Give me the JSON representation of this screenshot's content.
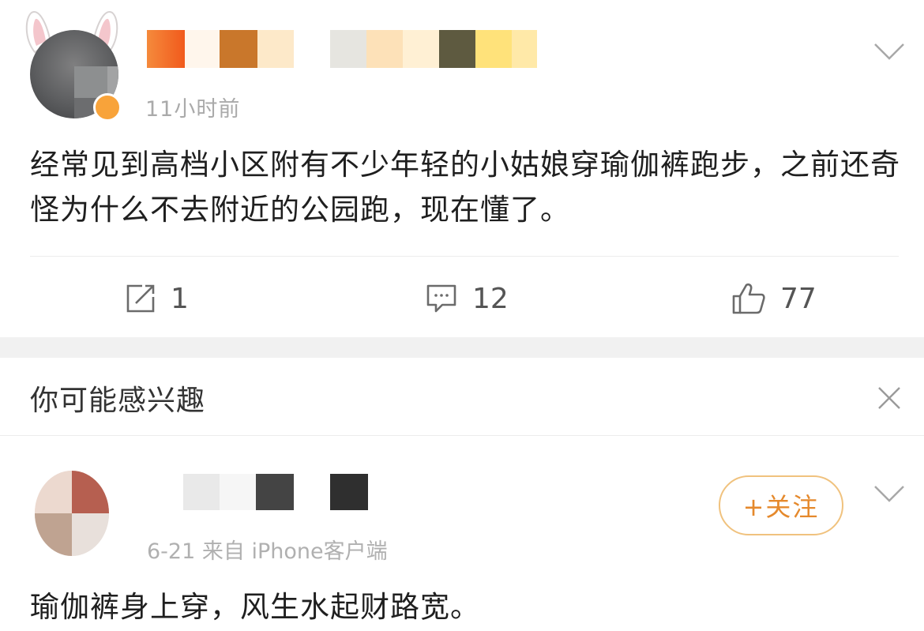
{
  "post": {
    "time": "11小时前",
    "content": "经常见到高档小区附有不少年轻的小姑娘穿瑜伽裤跑步，之前还奇怪为什么不去附近的公园跑，现在懂了。",
    "actions": {
      "repost_count": "1",
      "comment_count": "12",
      "like_count": "77"
    }
  },
  "interest": {
    "title": "你可能感兴趣"
  },
  "recommended_post": {
    "meta": "6-21  来自 iPhone客户端",
    "follow_label": "+关注",
    "content": "瑜伽裤身上穿，风生水起财路宽。"
  },
  "icons": {
    "dropdown": "chevron-down-icon",
    "repost": "repost-icon",
    "comment": "comment-icon",
    "like": "thumbs-up-icon",
    "close": "close-icon"
  },
  "colors": {
    "follow_accent": "#e5892c",
    "follow_border": "#f0c27e",
    "muted_text": "#aaaaaa",
    "separator": "#f1f1f1"
  }
}
